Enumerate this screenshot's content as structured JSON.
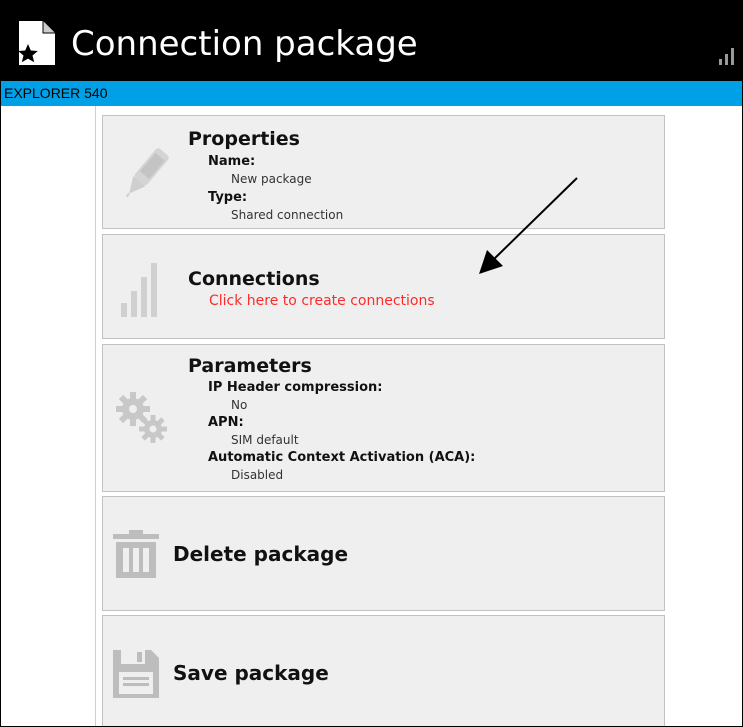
{
  "header": {
    "title": "Connection package",
    "device": "EXPLORER 540"
  },
  "properties": {
    "heading": "Properties",
    "name_label": "Name:",
    "name_value": "New package",
    "type_label": "Type:",
    "type_value": "Shared connection"
  },
  "connections": {
    "heading": "Connections",
    "hint": "Click here to create connections"
  },
  "parameters": {
    "heading": "Parameters",
    "ip_label": "IP Header compression:",
    "ip_value": "No",
    "apn_label": "APN:",
    "apn_value": "SIM default",
    "aca_label": "Automatic Context Activation (ACA):",
    "aca_value": "Disabled"
  },
  "actions": {
    "delete_label": "Delete package",
    "save_label": "Save package"
  },
  "colors": {
    "header_bg": "#000000",
    "subbar_bg": "#00a0e6",
    "hint_red": "#ff2a2a",
    "card_bg": "#efefef"
  },
  "icons": [
    "document-star-icon",
    "signal-icon",
    "pen-icon",
    "signal-bars-icon",
    "gears-icon",
    "trash-icon",
    "floppy-disk-icon",
    "arrow-icon"
  ]
}
